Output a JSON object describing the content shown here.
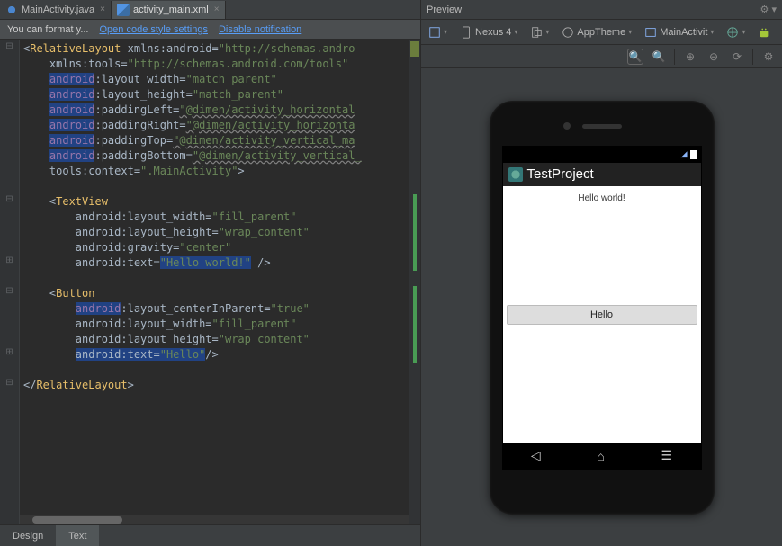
{
  "tabs": {
    "java": "MainActivity.java",
    "xml": "activity_main.xml"
  },
  "notif": {
    "msg": "You can format y...",
    "link1": "Open code style settings",
    "link2": "Disable notification"
  },
  "code": {
    "l1a": "<",
    "l1b": "RelativeLayout",
    "l1c": " xmlns:android=",
    "l1d": "\"http://schemas.andro",
    "l2a": "    xmlns:tools=",
    "l2d": "\"http://schemas.android.com/tools\"",
    "l3a": "    ",
    "l3b": "android",
    "l3c": ":layout_width=",
    "l3d": "\"match_parent\"",
    "l4a": "    ",
    "l4b": "android",
    "l4c": ":layout_height=",
    "l4d": "\"match_parent\"",
    "l5a": "    ",
    "l5b": "android",
    "l5c": ":paddingLeft=",
    "l5d": "\"@dimen/activity_horizontal",
    "l6a": "    ",
    "l6b": "android",
    "l6c": ":paddingRight=",
    "l6d": "\"@dimen/activity_horizonta",
    "l7a": "    ",
    "l7b": "android",
    "l7c": ":paddingTop=",
    "l7d": "\"@dimen/activity_vertical_ma",
    "l8a": "    ",
    "l8b": "android",
    "l8c": ":paddingBottom=",
    "l8d": "\"@dimen/activity_vertical_",
    "l9a": "    tools:context=",
    "l9d": "\".MainActivity\"",
    "l9e": ">",
    "l11a": "    <",
    "l11b": "TextView",
    "l12a": "        android:layout_width=",
    "l12d": "\"fill_parent\"",
    "l13a": "        android:layout_height=",
    "l13d": "\"wrap_content\"",
    "l14a": "        android:gravity=",
    "l14d": "\"center\"",
    "l15a": "        android:text=",
    "l15d": "\"Hello world!\"",
    "l15e": " />",
    "l17a": "    <",
    "l17b": "Button",
    "l18a": "        ",
    "l18b": "android",
    "l18c": ":layout_centerInParent=",
    "l18d": "\"true\"",
    "l19a": "        android:layout_width=",
    "l19d": "\"fill_parent\"",
    "l20a": "        android:layout_height=",
    "l20d": "\"wrap_content\"",
    "l21a": "        ",
    "l21b": "android:text=",
    "l21d": "\"Hello\"",
    "l21e": "/>",
    "l23a": "</",
    "l23b": "RelativeLayout",
    "l23e": ">"
  },
  "bottomTabs": {
    "design": "Design",
    "text": "Text"
  },
  "preview": {
    "title": "Preview"
  },
  "toolbar": {
    "device": "Nexus 4",
    "theme": "AppTheme",
    "activity": "MainActivit"
  },
  "phone": {
    "appTitle": "TestProject",
    "tvText": "Hello world!",
    "btnText": "Hello"
  }
}
